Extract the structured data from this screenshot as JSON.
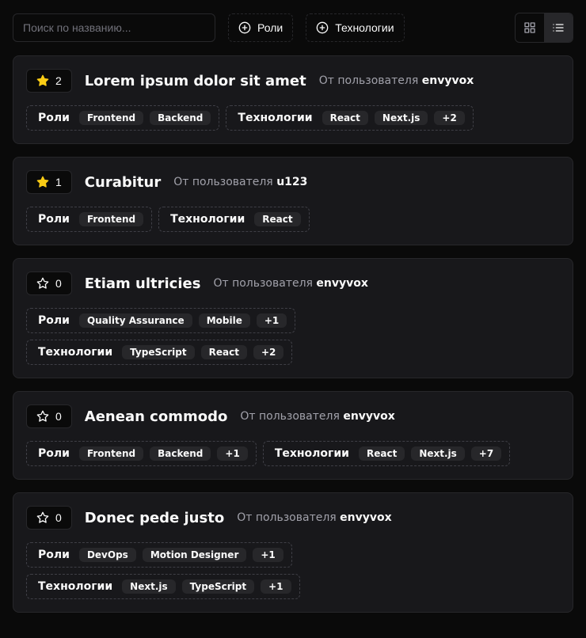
{
  "search": {
    "placeholder": "Поиск по названию..."
  },
  "filters": {
    "roles_label": "Роли",
    "tech_label": "Технологии"
  },
  "labels": {
    "roles": "Роли",
    "tech": "Технологии",
    "author_prefix": "От пользователя "
  },
  "cards": [
    {
      "stars": "2",
      "starred": true,
      "title": "Lorem ipsum dolor sit amet",
      "author": "envyvox",
      "roles": [
        "Frontend",
        "Backend"
      ],
      "roles_more": null,
      "tech": [
        "React",
        "Next.js"
      ],
      "tech_more": "+2"
    },
    {
      "stars": "1",
      "starred": true,
      "title": "Curabitur",
      "author": "u123",
      "roles": [
        "Frontend"
      ],
      "roles_more": null,
      "tech": [
        "React"
      ],
      "tech_more": null
    },
    {
      "stars": "0",
      "starred": false,
      "title": "Etiam ultricies",
      "author": "envyvox",
      "roles": [
        "Quality Assurance",
        "Mobile"
      ],
      "roles_more": "+1",
      "tech": [
        "TypeScript",
        "React"
      ],
      "tech_more": "+2"
    },
    {
      "stars": "0",
      "starred": false,
      "title": "Aenean commodo",
      "author": "envyvox",
      "roles": [
        "Frontend",
        "Backend"
      ],
      "roles_more": "+1",
      "tech": [
        "React",
        "Next.js"
      ],
      "tech_more": "+7"
    },
    {
      "stars": "0",
      "starred": false,
      "title": "Donec pede justo",
      "author": "envyvox",
      "roles": [
        "DevOps",
        "Motion Designer"
      ],
      "roles_more": "+1",
      "tech": [
        "Next.js",
        "TypeScript"
      ],
      "tech_more": "+1"
    }
  ]
}
